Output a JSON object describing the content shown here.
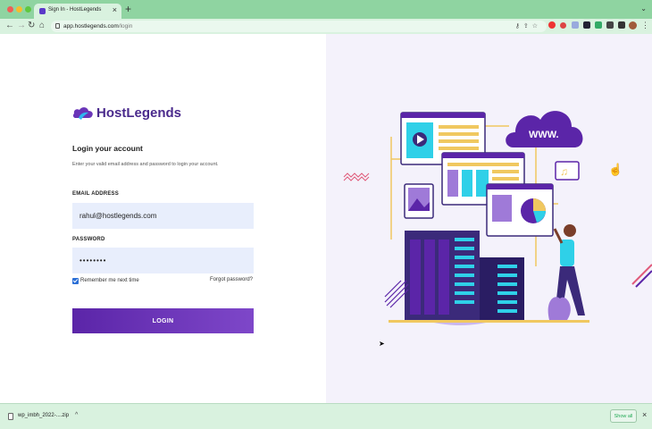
{
  "browser": {
    "tab_title": "Sign In - HostLegends",
    "tab_close": "×",
    "new_tab": "+",
    "tab_menu": "⌄",
    "url_host": "app.hostlegends.com",
    "url_path": "/login"
  },
  "nav": {
    "back": "←",
    "forward": "→",
    "reload": "↻",
    "home": "⌂",
    "menu": "⋮"
  },
  "login": {
    "brand": "HostLegends",
    "heading": "Login your account",
    "subtext": "Enter your valid email address and password to login your account.",
    "email_label": "EMAIL ADDRESS",
    "email_value": "rahul@hostlegends.com",
    "password_label": "PASSWORD",
    "password_value": "••••••••",
    "remember_label": "Remember me next time",
    "remember_checked": true,
    "forgot_label": "Forgot password?",
    "login_button": "LOGIN"
  },
  "illustration": {
    "www_label": "WWW."
  },
  "download": {
    "file_name": "wp_imbh_2022-....zip",
    "chevron": "^",
    "show_all": "Show all",
    "close": "×"
  },
  "colors": {
    "brand": "#4a2a8c",
    "accent": "#6a35b8",
    "chrome": "#8fd4a1",
    "input_bg": "#e8eefc"
  }
}
